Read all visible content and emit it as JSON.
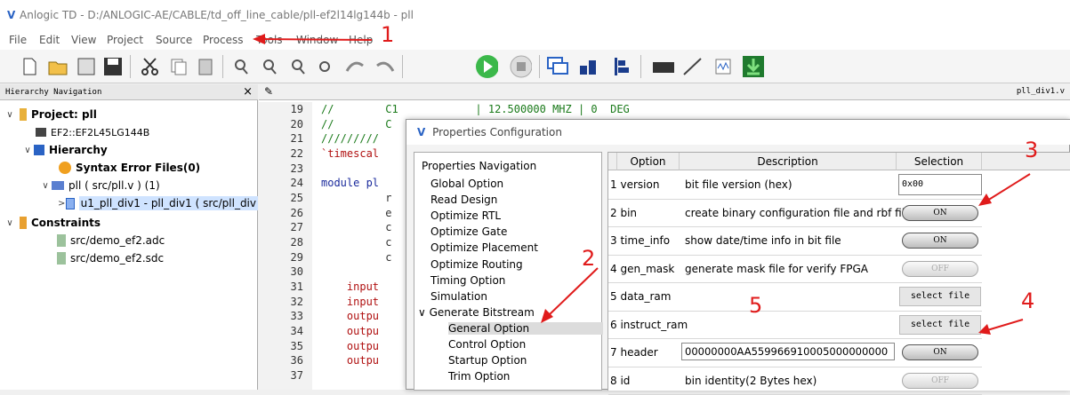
{
  "window": {
    "title": "Anlogic TD - D:/ANLOGIC-AE/CABLE/td_off_line_cable/pll-ef2l14lg144b - pll"
  },
  "menu": [
    "File",
    "Edit",
    "View",
    "Project",
    "Source",
    "Process",
    "Tools",
    "Window",
    "Help"
  ],
  "hierarchy": {
    "header": "Hierarchy Navigation",
    "close": "×",
    "project": "Project: pll",
    "device": "EF2::EF2L45LG144B",
    "hierarchy_label": "Hierarchy",
    "syntax_errors": "Syntax Error Files(0)",
    "top_module": "pll ( src/pll.v ) (1)",
    "sub_module": "u1_pll_div1 - pll_div1 ( src/pll_div",
    "constraints_label": "Constraints",
    "constraint_files": [
      "src/demo_ef2.adc",
      "src/demo_ef2.sdc"
    ]
  },
  "editor": {
    "tab": "pll_div1.v",
    "line_numbers": [
      "19",
      "20",
      "21",
      "22",
      "23",
      "24",
      "25",
      "26",
      "27",
      "28",
      "29",
      "30",
      "31",
      "32",
      "33",
      "34",
      "35",
      "36",
      "37"
    ],
    "lines": [
      "//        C1            | 12.500000 MHZ | 0  DEG",
      "//        C",
      "/////////",
      "`timescal",
      "",
      "module pl",
      "          r",
      "          e",
      "          c",
      "          c",
      "          c",
      "",
      "    input",
      "    input",
      "    outpu",
      "    outpu",
      "    outpu",
      "    outpu",
      ""
    ]
  },
  "dialog": {
    "title": "Properties Configuration",
    "nav_header": "Properties Navigation",
    "nav_items": [
      "Global Option",
      "Read Design",
      "Optimize RTL",
      "Optimize Gate",
      "Optimize Placement",
      "Optimize Routing",
      "Timing Option",
      "Simulation",
      "Generate Bitstream",
      "General Option",
      "Control Option",
      "Startup Option",
      "Trim Option"
    ],
    "columns": [
      "Option",
      "Description",
      "Selection"
    ],
    "rows": [
      {
        "num": "1",
        "option": "version",
        "description": "bit file version (hex)",
        "value": "0x00",
        "kind": "input"
      },
      {
        "num": "2",
        "option": "bin",
        "description": "create binary configuration file and rbf file",
        "value": "ON",
        "kind": "on"
      },
      {
        "num": "3",
        "option": "time_info",
        "description": "show date/time info in bit file",
        "value": "ON",
        "kind": "on"
      },
      {
        "num": "4",
        "option": "gen_mask",
        "description": "generate mask file for verify FPGA",
        "value": "OFF",
        "kind": "off"
      },
      {
        "num": "5",
        "option": "data_ram",
        "description": "",
        "value": "select file",
        "kind": "file"
      },
      {
        "num": "6",
        "option": "instruct_ram",
        "description": "",
        "value": "select file",
        "kind": "file"
      },
      {
        "num": "7",
        "option": "header",
        "description": "00000000AA559966910005000000000",
        "value": "ON",
        "kind": "on",
        "desc_is_input": true
      },
      {
        "num": "8",
        "option": "id",
        "description": "bin identity(2 Bytes hex)",
        "value": "OFF",
        "kind": "off"
      }
    ]
  },
  "annotations": [
    "1",
    "2",
    "3",
    "4",
    "5"
  ],
  "colors": {
    "annotation_red": "#e01b1b",
    "accent_blue": "#2a63c4",
    "selected_row": "#dcdcdc"
  }
}
